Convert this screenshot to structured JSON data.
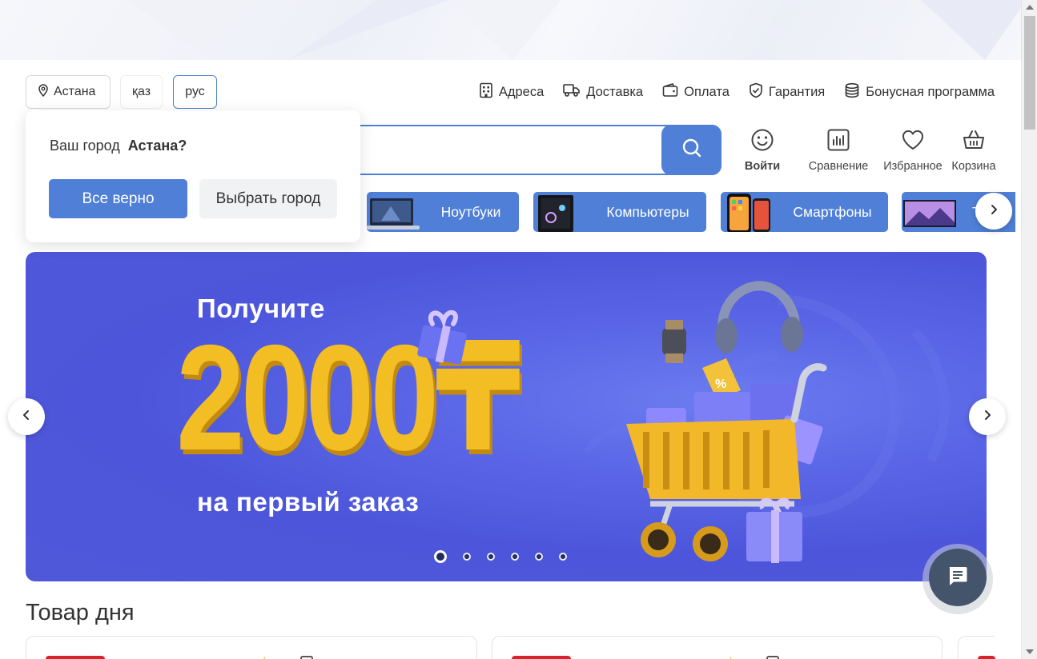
{
  "header": {
    "city": "Астана",
    "lang_kz": "қаз",
    "lang_ru": "рус",
    "nav": [
      {
        "label": "Адреса",
        "icon": "building-icon"
      },
      {
        "label": "Доставка",
        "icon": "truck-icon"
      },
      {
        "label": "Оплата",
        "icon": "wallet-icon"
      },
      {
        "label": "Гарантия",
        "icon": "shield-check-icon"
      },
      {
        "label": "Бонусная программа",
        "icon": "coins-icon"
      }
    ]
  },
  "search": {
    "placeholder": ""
  },
  "actions": [
    {
      "label": "Войти",
      "icon": "smile-icon"
    },
    {
      "label": "Сравнение",
      "icon": "chart-icon"
    },
    {
      "label": "Избранное",
      "icon": "heart-icon"
    },
    {
      "label": "Корзина",
      "icon": "basket-icon"
    }
  ],
  "categories": [
    {
      "label": "Ноутбуки"
    },
    {
      "label": "Компьютеры"
    },
    {
      "label": "Смартфоны"
    },
    {
      "label": "Т"
    }
  ],
  "city_popup": {
    "question": "Ваш город",
    "city": "Астана?",
    "confirm": "Все верно",
    "choose": "Выбрать город"
  },
  "banner": {
    "line1": "Получите",
    "amount": "2000₸",
    "line2": "на первый заказ",
    "slide_count": 6,
    "active_slide": 1
  },
  "deal": {
    "title": "Товар дня"
  },
  "colors": {
    "accent": "#4f7fd6",
    "banner": "#5560e0",
    "amount": "#f3bd24",
    "fab": "#44546a"
  }
}
